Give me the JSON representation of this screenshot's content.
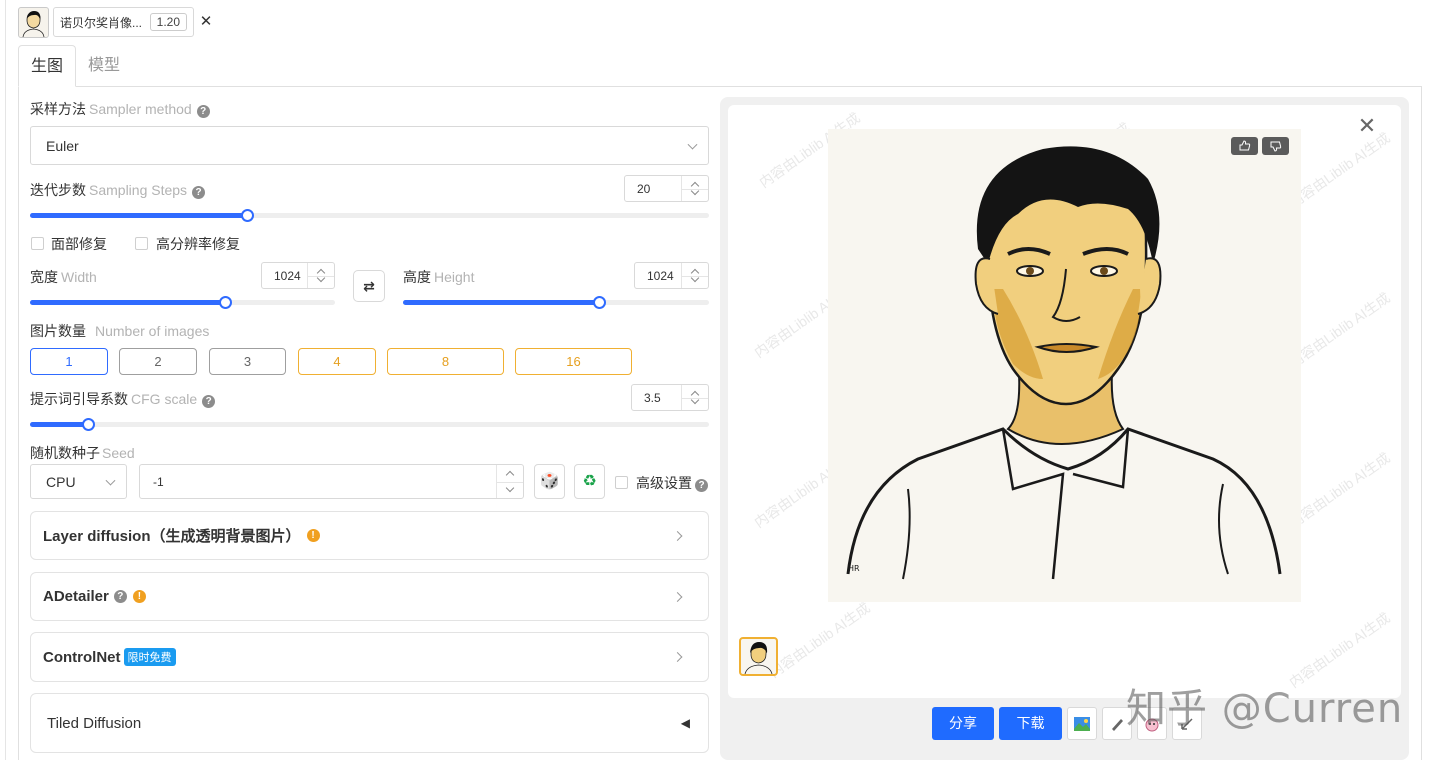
{
  "history": {
    "title": "诺贝尔奖肖像...",
    "version": "1.20",
    "close": "✕"
  },
  "tabs": [
    "生图",
    "模型"
  ],
  "sampler": {
    "label_cn": "采样方法",
    "label_en": "Sampler method",
    "value": "Euler"
  },
  "steps": {
    "label_cn": "迭代步数",
    "label_en": "Sampling Steps",
    "value": "20",
    "fraction": 0.32
  },
  "options": {
    "face_restore": "面部修复",
    "hires_fix": "高分辨率修复"
  },
  "width": {
    "label_cn": "宽度",
    "label_en": "Width",
    "value": "1024",
    "fraction": 0.64
  },
  "height": {
    "label_cn": "高度",
    "label_en": "Height",
    "value": "1024",
    "fraction": 0.64
  },
  "swap_icon": "⇄",
  "image_count": {
    "label_cn": "图片数量",
    "label_en": "Number of images",
    "options": [
      "1",
      "2",
      "3",
      "4",
      "8",
      "16"
    ],
    "selected": "1"
  },
  "cfg": {
    "label_cn": "提示词引导系数",
    "label_en": "CFG scale",
    "value": "3.5",
    "fraction": 0.086
  },
  "seed": {
    "label_cn": "随机数种子",
    "label_en": "Seed",
    "device": "CPU",
    "value": "-1",
    "dice_icon": "🎲",
    "recycle_icon": "♻",
    "advanced": "高级设置"
  },
  "accordions": {
    "layer_diffusion": "Layer diffusion（生成透明背景图片）",
    "adetailer": "ADetailer",
    "controlnet": "ControlNet",
    "controlnet_badge": "限时免费",
    "tiled_diffusion": "Tiled Diffusion",
    "tiled_arrow": "◀"
  },
  "preview": {
    "close": "✕",
    "share": "分享",
    "download": "下载"
  },
  "watermark": "知乎 @Curren",
  "colors": {
    "accent": "#2f6bff",
    "gold": "#f0b032",
    "button": "#1f6bff"
  }
}
